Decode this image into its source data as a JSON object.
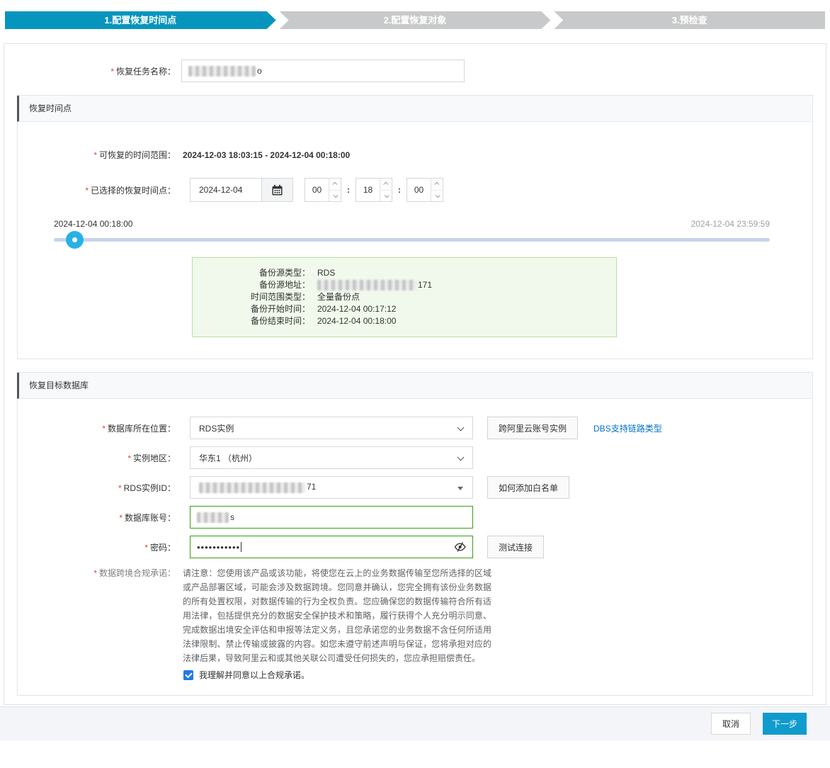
{
  "steps": [
    {
      "label": "1.配置恢复时间点"
    },
    {
      "label": "2.配置恢复对象"
    },
    {
      "label": "3.预检查"
    }
  ],
  "required_marker": "*",
  "task_name": {
    "label": "恢复任务名称：",
    "visible_suffix": "o"
  },
  "restore_time": {
    "title": "恢复时间点",
    "range_label": "可恢复的时间范围：",
    "range_value": "2024-12-03 18:03:15 - 2024-12-04 00:18:00",
    "selected_label": "已选择的恢复时间点：",
    "date": "2024-12-04",
    "hour": "00",
    "minute": "18",
    "second": "00",
    "time_separator": ":",
    "slider_min_label": "2024-12-04 00:18:00",
    "slider_max_label": "2024-12-04 23:59:59",
    "backup_info": {
      "source_type_label": "备份源类型：",
      "source_type": "RDS",
      "source_addr_label": "备份源地址：",
      "source_addr_suffix": "171",
      "range_type_label": "时间范围类型：",
      "range_type": "全量备份点",
      "start_label": "备份开始时间：",
      "start": "2024-12-04 00:17:12",
      "end_label": "备份结束时间：",
      "end": "2024-12-04 00:18:00"
    }
  },
  "target_db": {
    "title": "恢复目标数据库",
    "location_label": "数据库所在位置：",
    "location_value": "RDS实例",
    "cross_account_button": "跨阿里云账号实例",
    "dbs_link": "DBS支持链路类型",
    "region_label": "实例地区：",
    "region_value": "华东1 （杭州）",
    "instance_label": "RDS实例ID：",
    "instance_suffix": "71",
    "whitelist_button": "如何添加白名单",
    "account_label": "数据库账号：",
    "account_suffix": "s",
    "password_label": "密码：",
    "password_masked": "•••••••••••",
    "test_connection_button": "测试连接",
    "compliance_label": "数据跨境合规承诺：",
    "compliance_text": "请注意：您使用该产品或该功能，将使您在云上的业务数据传输至您所选择的区域或产品部署区域，可能会涉及数据跨境。您同意并确认，您完全拥有该份业务数据的所有处置权限，对数据传输的行为全权负责。您应确保您的数据传输符合所有适用法律，包括提供充分的数据安全保护技术和策略，履行获得个人充分明示同意、完成数据出境安全评估和申报等法定义务，且您承诺您的业务数据不含任何所适用法律限制、禁止传输或披露的内容。如您未遵守前述声明与保证，您将承担对应的法律后果，导致阿里云和或其他关联公司遭受任何损失的，您应承担赔偿责任。",
    "agree_text": "我理解并同意以上合规承诺。"
  },
  "footer": {
    "cancel": "取消",
    "next": "下一步"
  },
  "colors": {
    "step_active": "#0795bd",
    "step_inactive": "#c8c9ca",
    "next_button": "#109bcd",
    "link_blue": "#0070cc",
    "valid_input_border": "#3a9c16",
    "info_box_bg": "#f0f9eb",
    "info_box_border": "#b9dfa6",
    "slider_handle": "#27b2e5",
    "checkbox_checked": "#1f7be8"
  }
}
